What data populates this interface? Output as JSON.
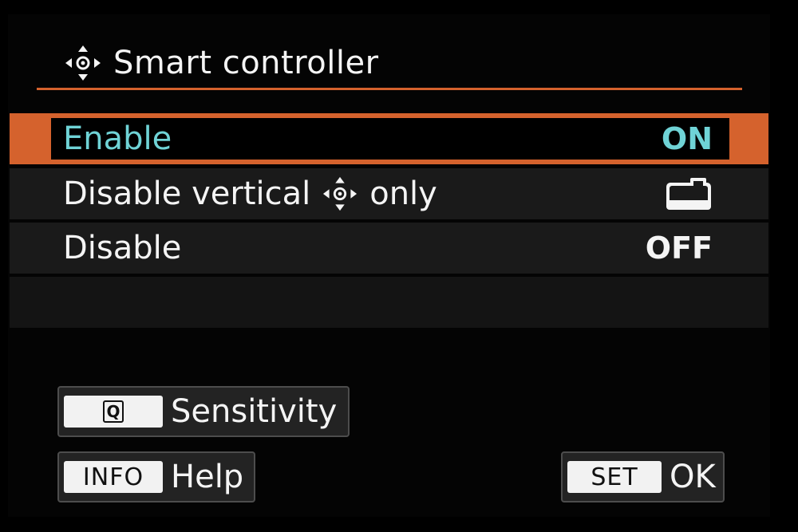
{
  "header": {
    "title": "Smart controller",
    "icon": "smart-controller-icon"
  },
  "menu": {
    "items": [
      {
        "label": "Enable",
        "value": "ON",
        "selected": true
      },
      {
        "label_prefix": "Disable vertical",
        "label_icon": "smart-controller-icon",
        "label_suffix": "only",
        "value_icon": "camera-icon",
        "selected": false
      },
      {
        "label": "Disable",
        "value": "OFF",
        "selected": false
      }
    ]
  },
  "buttons": {
    "sensitivity": {
      "key": "Q",
      "label": "Sensitivity"
    },
    "help": {
      "key": "INFO",
      "label": "Help"
    },
    "ok": {
      "key": "SET",
      "label": "OK"
    }
  },
  "colors": {
    "accent": "#d5622d",
    "selected_text": "#6fd3d6",
    "row_bg": "#1a1a1a",
    "background": "#000000"
  }
}
